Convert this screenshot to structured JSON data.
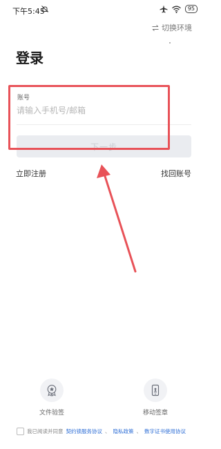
{
  "status_bar": {
    "time": "下午5:45",
    "battery": "95",
    "icons": [
      "mute-icon",
      "airplane-icon",
      "wifi-icon",
      "battery-icon"
    ]
  },
  "header": {
    "switch_env_label": "切换环境",
    "switch_env_icon": "swap-arrows-icon",
    "title": "登录"
  },
  "form": {
    "account_label": "账号",
    "account_placeholder": "请输入手机号/邮箱",
    "account_value": "",
    "next_button": "下一步"
  },
  "links": {
    "register": "立即注册",
    "recover": "找回账号"
  },
  "features": [
    {
      "label": "文件验签",
      "icon": "seal-verify-icon"
    },
    {
      "label": "移动签章",
      "icon": "mobile-sign-icon"
    }
  ],
  "agreement": {
    "prefix": "我已阅读并同意",
    "links": [
      "契约锁服务协议",
      "隐私政策",
      "数字证书使用协议"
    ],
    "sep": "、"
  },
  "colors": {
    "highlight": "#e85258",
    "link": "#2f6fd6",
    "button_disabled_bg": "#eaecf0"
  }
}
